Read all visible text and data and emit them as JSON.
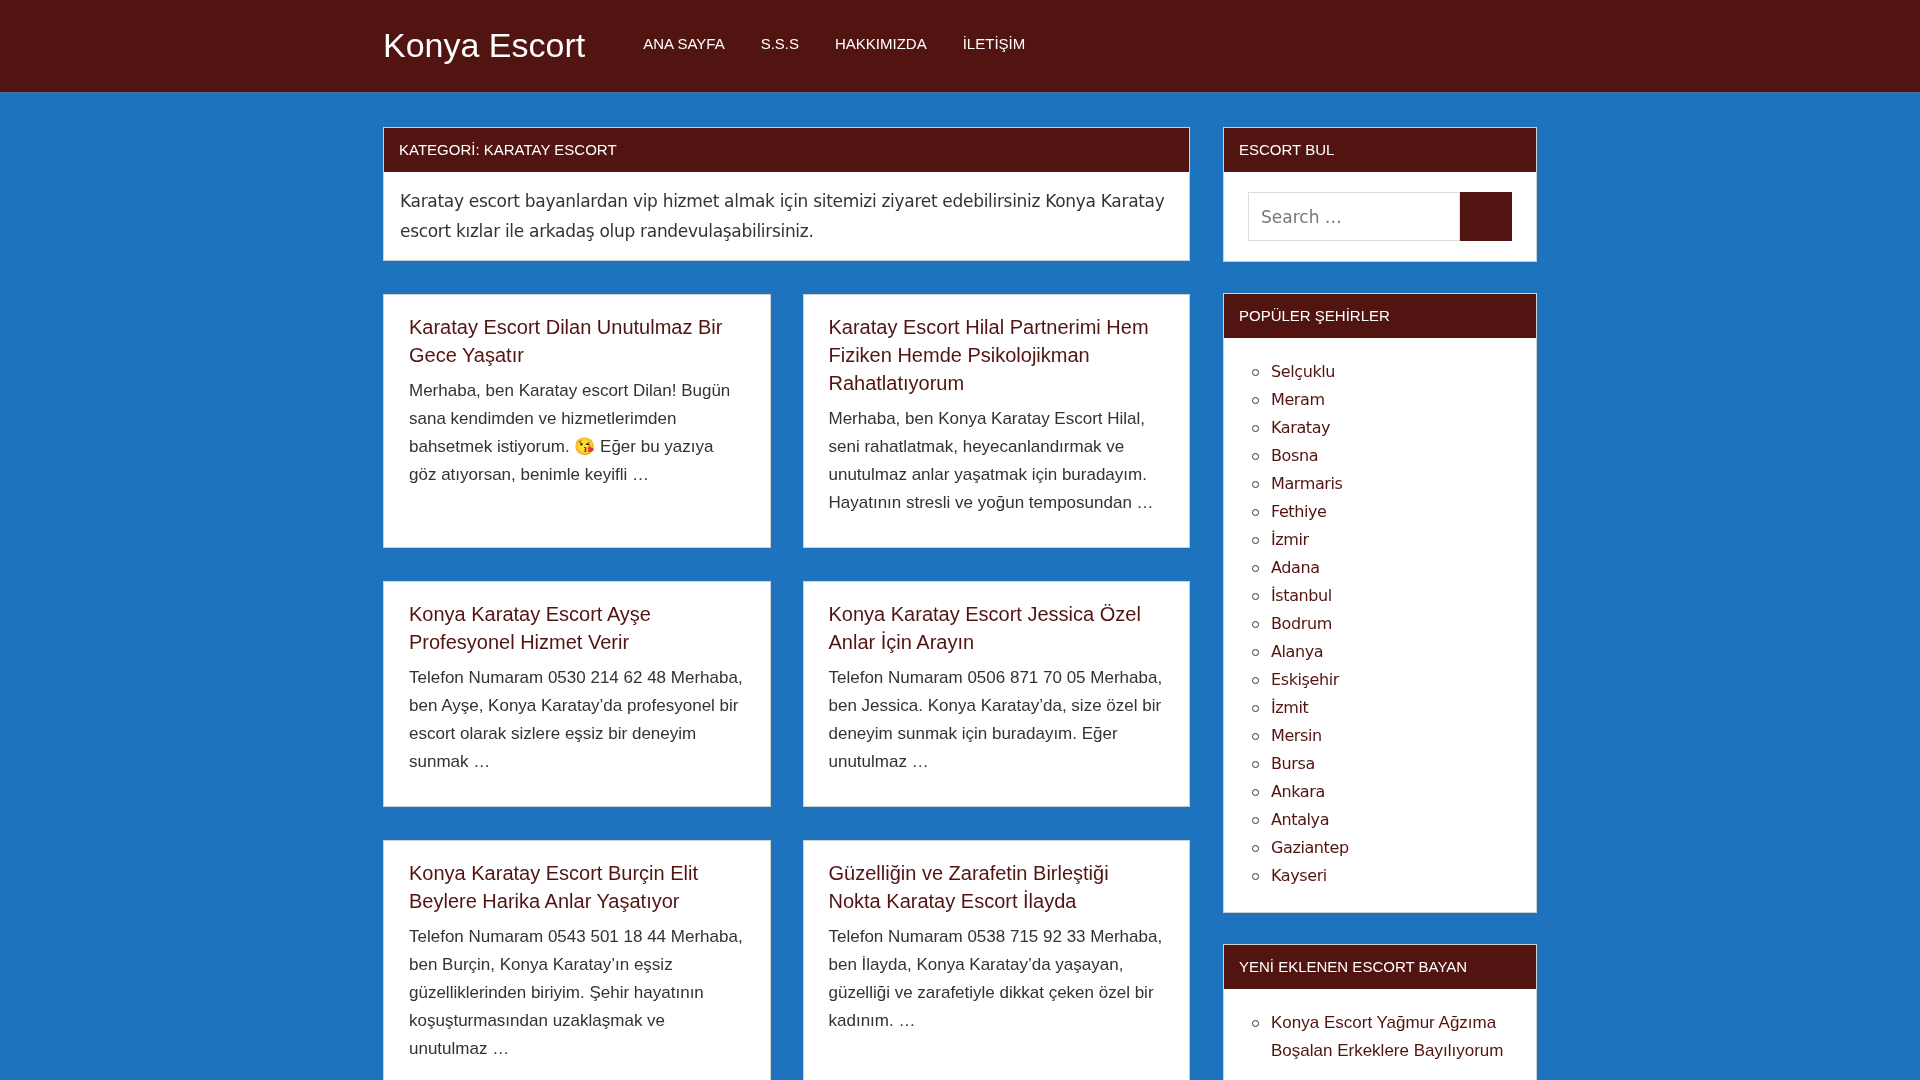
{
  "header": {
    "site_title": "Konya Escort",
    "nav": [
      {
        "label": "ANA SAYFA"
      },
      {
        "label": "S.S.S"
      },
      {
        "label": "HAKKIMIZDA"
      },
      {
        "label": "İLETİŞİM"
      }
    ]
  },
  "category": {
    "title": "KATEGORİ: KARATAY ESCORT",
    "description": "Karatay escort bayanlardan vip hizmet almak için sitemizi ziyaret edebilirsiniz Konya Karatay escort kızlar ile arkadaş olup randevulaşabilirsiniz."
  },
  "posts": [
    {
      "title": "Karatay Escort Dilan Unutulmaz Bir Gece Yaşatır",
      "excerpt": "Merhaba, ben Karatay escort Dilan! Bugün sana kendimden ve hizmetlerimden bahsetmek istiyorum. 😘 Eğer bu yazıya göz atıyorsan, benimle keyifli …"
    },
    {
      "title": "Karatay Escort Hilal Partnerimi Hem Fiziken Hemde Psikolojikman Rahatlatıyorum",
      "excerpt": "Merhaba, ben Konya Karatay Escort Hilal, seni rahatlatmak, heyecanlandırmak ve unutulmaz anlar yaşatmak için buradayım. Hayatının stresli ve yoğun temposundan …"
    },
    {
      "title": "Konya Karatay Escort Ayşe Profesyonel Hizmet Verir",
      "excerpt": "Telefon Numaram 0530 214 62 48 Merhaba, ben Ayşe, Konya Karatay’da profesyonel bir escort olarak sizlere eşsiz bir deneyim sunmak …"
    },
    {
      "title": "Konya Karatay Escort Jessica Özel Anlar İçin Arayın",
      "excerpt": "Telefon Numaram 0506 871 70 05 Merhaba, ben Jessica. Konya Karatay’da, size özel bir deneyim sunmak için buradayım. Eğer unutulmaz …"
    },
    {
      "title": "Konya Karatay Escort Burçin Elit Beylere Harika Anlar Yaşatıyor",
      "excerpt": "Telefon Numaram 0543 501 18 44 Merhaba, ben Burçin, Konya Karatay’ın eşsiz güzelliklerinden biriyim. Şehir hayatının koşuşturmasından uzaklaşmak ve unutulmaz …"
    },
    {
      "title": "Güzelliğin ve Zarafetin Birleştiği Nokta Karatay Escort İlayda",
      "excerpt": "Telefon Numaram 0538 715 92 33 Merhaba, ben İlayda, Konya Karatay’da yaşayan, güzelliği ve zarafetiyle dikkat çeken özel bir kadınım. …"
    }
  ],
  "sidebar": {
    "search_widget": {
      "title": "ESCORT BUL",
      "placeholder": "Search …"
    },
    "cities_widget": {
      "title": "POPÜLER ŞEHİRLER",
      "items": [
        "Selçuklu",
        "Meram",
        "Karatay",
        "Bosna",
        "Marmaris",
        "Fethiye",
        "İzmir",
        "Adana",
        "İstanbul",
        "Bodrum",
        "Alanya",
        "Eskişehir",
        "İzmit",
        "Mersin",
        "Bursa",
        "Ankara",
        "Antalya",
        "Gaziantep",
        "Kayseri"
      ]
    },
    "recent_widget": {
      "title": "YENİ EKLENEN ESCORT BAYAN",
      "items": [
        "Konya Escort Yağmur Ağzıma Boşalan Erkeklere Bayılıyorum"
      ]
    }
  }
}
